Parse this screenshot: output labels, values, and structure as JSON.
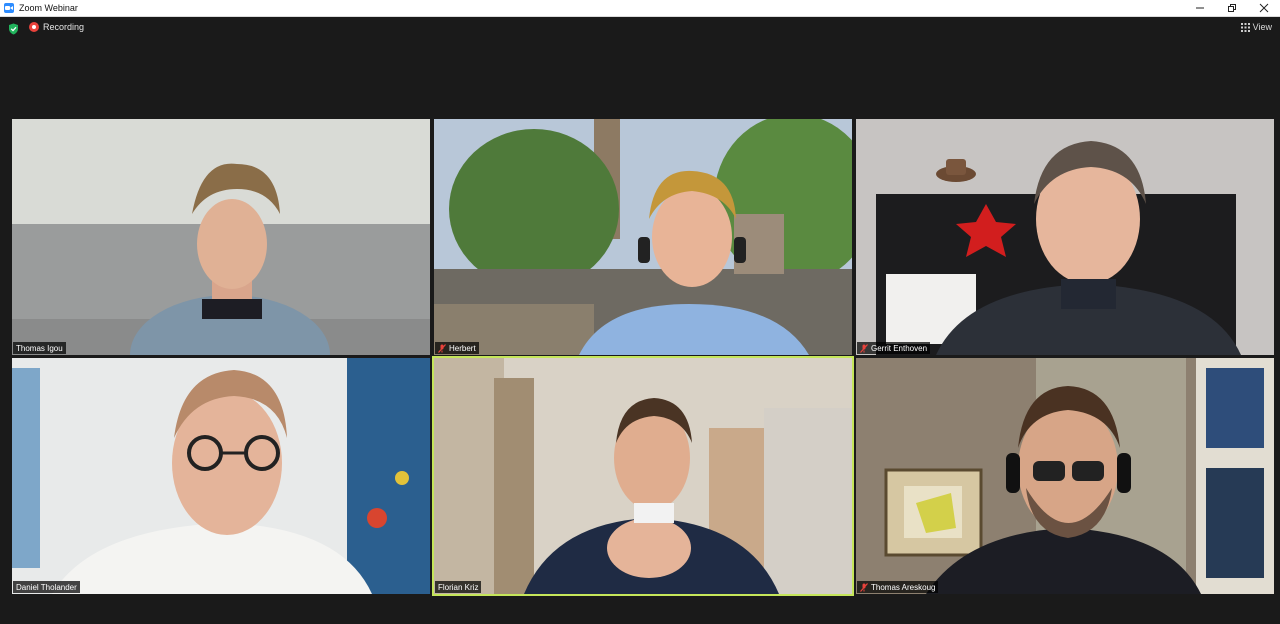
{
  "window": {
    "title": "Zoom Webinar"
  },
  "toolbar": {
    "recording_label": "Recording",
    "view_label": "View"
  },
  "colors": {
    "active_speaker_border": "#c5e65a",
    "recording_red": "#e8423b",
    "secure_green": "#21b35c",
    "mute_red": "#e8423b"
  },
  "participants": [
    {
      "name": "Thomas Igou",
      "muted": false,
      "active": false
    },
    {
      "name": "Herbert",
      "muted": true,
      "active": false
    },
    {
      "name": "Gerrit Enthoven",
      "muted": true,
      "active": false
    },
    {
      "name": "Daniel Tholander",
      "muted": false,
      "active": false
    },
    {
      "name": "Florian Kriz",
      "muted": false,
      "active": true
    },
    {
      "name": "Thomas Areskoug",
      "muted": true,
      "active": false
    }
  ]
}
